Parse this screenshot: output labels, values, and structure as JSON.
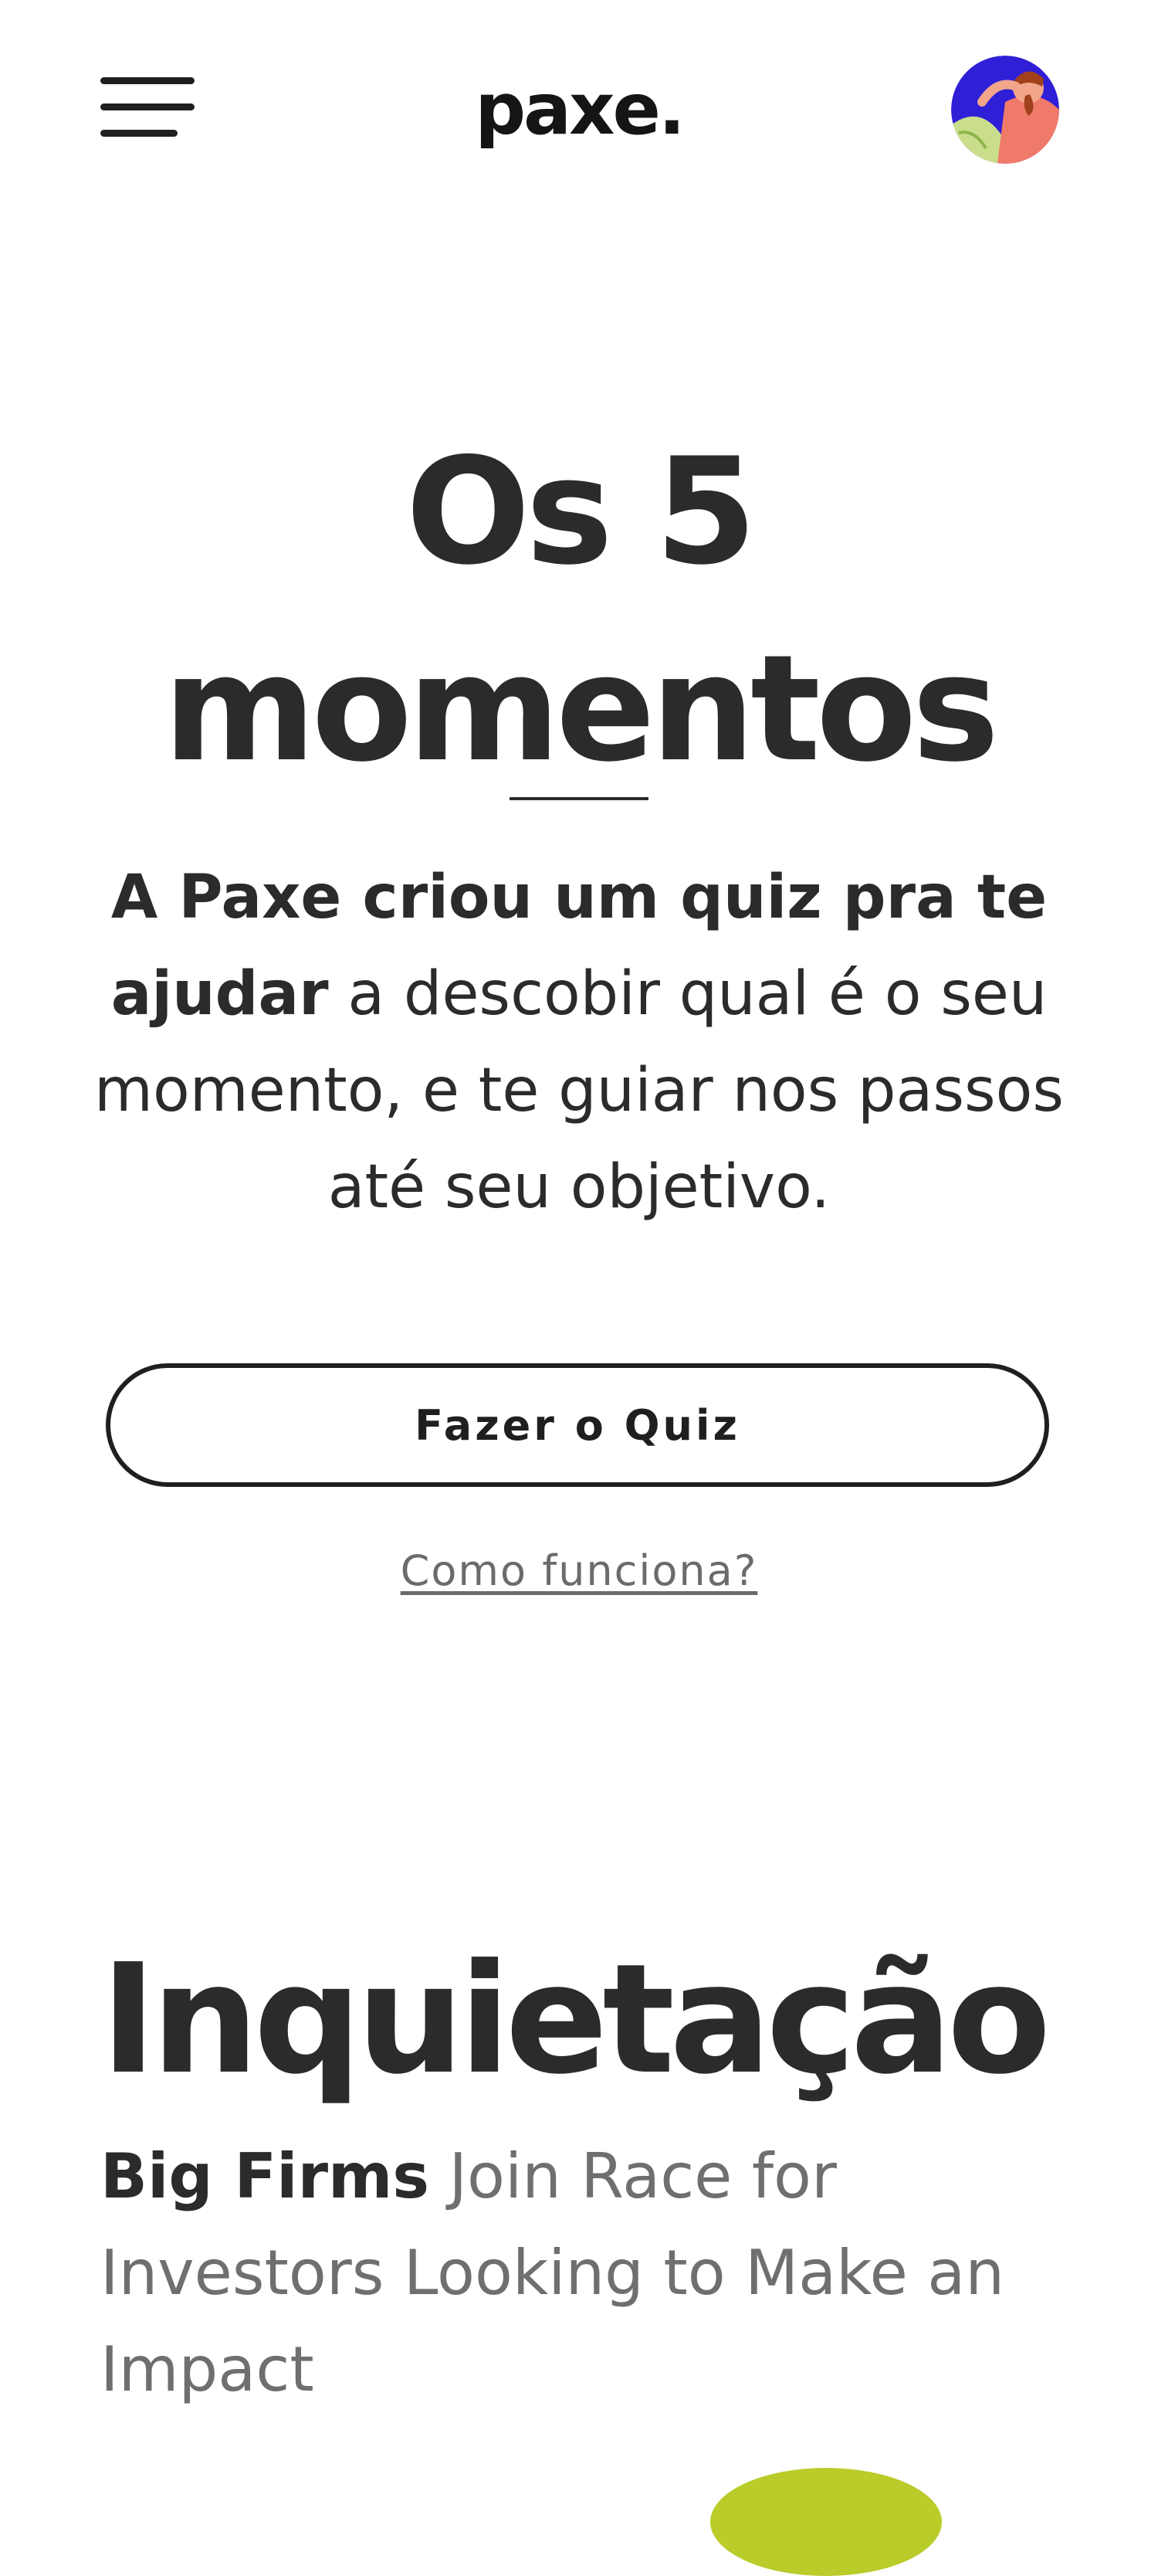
{
  "header": {
    "logo": "paxe.",
    "menu_icon": "hamburger-menu-icon",
    "avatar_icon": "user-avatar-illustration"
  },
  "hero": {
    "title_line1": "Os 5",
    "title_line2": "momentos",
    "intro_bold": "A Paxe criou um quiz pra te ajudar",
    "intro_rest": " a descobir qual é o seu momento, e te guiar nos passos até seu objetivo.",
    "cta_label": "Fazer o Quiz",
    "link_label": "Como funciona?"
  },
  "section": {
    "title": "Inquietação",
    "text_bold": "Big Firms",
    "text_rest": " Join Race for Investors Looking to Make an Impact"
  },
  "colors": {
    "text_dark": "#2b2b2b",
    "text_muted": "#6f6f6f",
    "accent_green": "#b9cc2a",
    "avatar_blue": "#2f1fd6"
  }
}
